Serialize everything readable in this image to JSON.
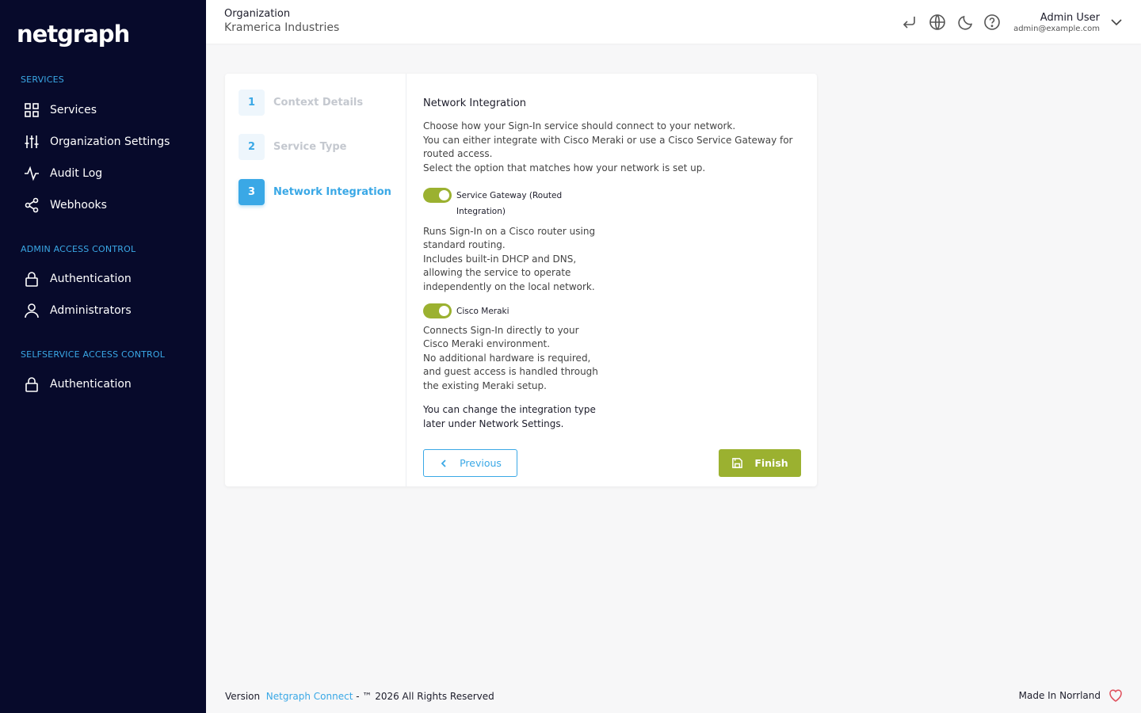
{
  "sidebar": {
    "logo": "netgraph",
    "sections": [
      {
        "title": "SERVICES"
      },
      {
        "title": "ADMIN ACCESS CONTROL"
      },
      {
        "title": "SELFSERVICE ACCESS CONTROL"
      }
    ],
    "items": [
      {
        "label": "Services",
        "icon": "grid-icon"
      },
      {
        "label": "Organization Settings",
        "icon": "sliders-icon"
      },
      {
        "label": "Audit Log",
        "icon": "activity-icon"
      },
      {
        "label": "Webhooks",
        "icon": "share-icon"
      },
      {
        "label": "Authentication",
        "icon": "lock-icon"
      },
      {
        "label": "Administrators",
        "icon": "user-icon"
      },
      {
        "label": "Authentication",
        "icon": "lock-icon"
      }
    ]
  },
  "header": {
    "org_label": "Organization",
    "org_name": "Kramerica Industries",
    "icons": [
      "return-icon",
      "globe-icon",
      "moon-icon",
      "help-icon"
    ],
    "user_name": "Admin User",
    "user_email": "admin@example.com"
  },
  "wizard": {
    "steps": [
      {
        "number": "1",
        "label": "Context Details"
      },
      {
        "number": "2",
        "label": "Service Type"
      },
      {
        "number": "3",
        "label": "Network Integration"
      }
    ],
    "active_step": 3,
    "title": "Network Integration",
    "intro": [
      "Choose how your Sign-In service should connect to your network.",
      "You can either integrate with Cisco Meraki or use a Cisco Service Gateway for",
      "routed access.",
      "Select the option that matches how your network is set up."
    ],
    "options": [
      {
        "label": "Service Gateway (Routed Integration)",
        "enabled": true,
        "description": [
          "Runs Sign-In on a Cisco router using",
          "standard routing.",
          "Includes built-in DHCP and DNS,",
          "allowing the service to operate",
          "independently on the local network."
        ]
      },
      {
        "label": "Cisco Meraki",
        "enabled": true,
        "description": [
          "Connects Sign-In directly to your",
          "Cisco Meraki environment.",
          "No additional hardware is required,",
          "and guest access is handled through",
          "the existing Meraki setup."
        ]
      }
    ],
    "note": [
      "You can change the integration type",
      "later under Network Settings."
    ],
    "prev_label": "Previous",
    "finish_label": "Finish"
  },
  "footer": {
    "version_label": "Version",
    "product_link": "Netgraph Connect",
    "rights": "- ™ 2026 All Rights Reserved",
    "made_in": "Made In Norrland"
  },
  "colors": {
    "sidebar_bg": "#070a2b",
    "accent_blue": "#3aa8e6",
    "accent_green": "#9bb130",
    "heart": "#e0535f"
  }
}
